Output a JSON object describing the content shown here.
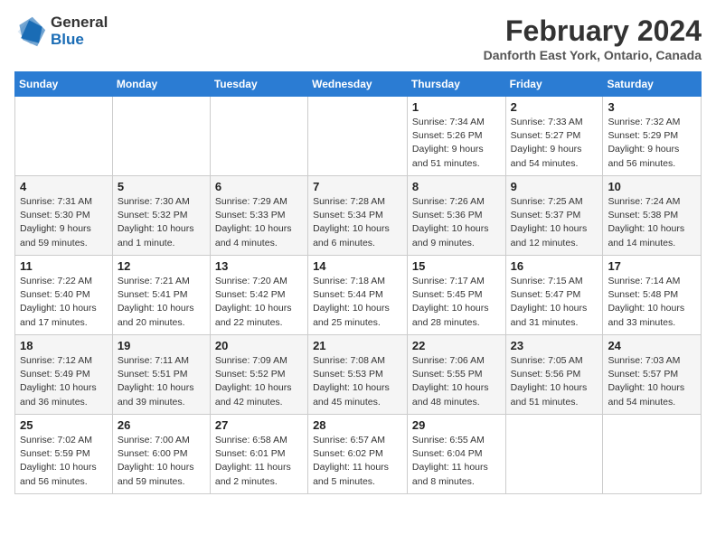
{
  "logo": {
    "line1": "General",
    "line2": "Blue"
  },
  "title": "February 2024",
  "location": "Danforth East York, Ontario, Canada",
  "weekdays": [
    "Sunday",
    "Monday",
    "Tuesday",
    "Wednesday",
    "Thursday",
    "Friday",
    "Saturday"
  ],
  "weeks": [
    [
      {
        "num": "",
        "info": ""
      },
      {
        "num": "",
        "info": ""
      },
      {
        "num": "",
        "info": ""
      },
      {
        "num": "",
        "info": ""
      },
      {
        "num": "1",
        "info": "Sunrise: 7:34 AM\nSunset: 5:26 PM\nDaylight: 9 hours\nand 51 minutes."
      },
      {
        "num": "2",
        "info": "Sunrise: 7:33 AM\nSunset: 5:27 PM\nDaylight: 9 hours\nand 54 minutes."
      },
      {
        "num": "3",
        "info": "Sunrise: 7:32 AM\nSunset: 5:29 PM\nDaylight: 9 hours\nand 56 minutes."
      }
    ],
    [
      {
        "num": "4",
        "info": "Sunrise: 7:31 AM\nSunset: 5:30 PM\nDaylight: 9 hours\nand 59 minutes."
      },
      {
        "num": "5",
        "info": "Sunrise: 7:30 AM\nSunset: 5:32 PM\nDaylight: 10 hours\nand 1 minute."
      },
      {
        "num": "6",
        "info": "Sunrise: 7:29 AM\nSunset: 5:33 PM\nDaylight: 10 hours\nand 4 minutes."
      },
      {
        "num": "7",
        "info": "Sunrise: 7:28 AM\nSunset: 5:34 PM\nDaylight: 10 hours\nand 6 minutes."
      },
      {
        "num": "8",
        "info": "Sunrise: 7:26 AM\nSunset: 5:36 PM\nDaylight: 10 hours\nand 9 minutes."
      },
      {
        "num": "9",
        "info": "Sunrise: 7:25 AM\nSunset: 5:37 PM\nDaylight: 10 hours\nand 12 minutes."
      },
      {
        "num": "10",
        "info": "Sunrise: 7:24 AM\nSunset: 5:38 PM\nDaylight: 10 hours\nand 14 minutes."
      }
    ],
    [
      {
        "num": "11",
        "info": "Sunrise: 7:22 AM\nSunset: 5:40 PM\nDaylight: 10 hours\nand 17 minutes."
      },
      {
        "num": "12",
        "info": "Sunrise: 7:21 AM\nSunset: 5:41 PM\nDaylight: 10 hours\nand 20 minutes."
      },
      {
        "num": "13",
        "info": "Sunrise: 7:20 AM\nSunset: 5:42 PM\nDaylight: 10 hours\nand 22 minutes."
      },
      {
        "num": "14",
        "info": "Sunrise: 7:18 AM\nSunset: 5:44 PM\nDaylight: 10 hours\nand 25 minutes."
      },
      {
        "num": "15",
        "info": "Sunrise: 7:17 AM\nSunset: 5:45 PM\nDaylight: 10 hours\nand 28 minutes."
      },
      {
        "num": "16",
        "info": "Sunrise: 7:15 AM\nSunset: 5:47 PM\nDaylight: 10 hours\nand 31 minutes."
      },
      {
        "num": "17",
        "info": "Sunrise: 7:14 AM\nSunset: 5:48 PM\nDaylight: 10 hours\nand 33 minutes."
      }
    ],
    [
      {
        "num": "18",
        "info": "Sunrise: 7:12 AM\nSunset: 5:49 PM\nDaylight: 10 hours\nand 36 minutes."
      },
      {
        "num": "19",
        "info": "Sunrise: 7:11 AM\nSunset: 5:51 PM\nDaylight: 10 hours\nand 39 minutes."
      },
      {
        "num": "20",
        "info": "Sunrise: 7:09 AM\nSunset: 5:52 PM\nDaylight: 10 hours\nand 42 minutes."
      },
      {
        "num": "21",
        "info": "Sunrise: 7:08 AM\nSunset: 5:53 PM\nDaylight: 10 hours\nand 45 minutes."
      },
      {
        "num": "22",
        "info": "Sunrise: 7:06 AM\nSunset: 5:55 PM\nDaylight: 10 hours\nand 48 minutes."
      },
      {
        "num": "23",
        "info": "Sunrise: 7:05 AM\nSunset: 5:56 PM\nDaylight: 10 hours\nand 51 minutes."
      },
      {
        "num": "24",
        "info": "Sunrise: 7:03 AM\nSunset: 5:57 PM\nDaylight: 10 hours\nand 54 minutes."
      }
    ],
    [
      {
        "num": "25",
        "info": "Sunrise: 7:02 AM\nSunset: 5:59 PM\nDaylight: 10 hours\nand 56 minutes."
      },
      {
        "num": "26",
        "info": "Sunrise: 7:00 AM\nSunset: 6:00 PM\nDaylight: 10 hours\nand 59 minutes."
      },
      {
        "num": "27",
        "info": "Sunrise: 6:58 AM\nSunset: 6:01 PM\nDaylight: 11 hours\nand 2 minutes."
      },
      {
        "num": "28",
        "info": "Sunrise: 6:57 AM\nSunset: 6:02 PM\nDaylight: 11 hours\nand 5 minutes."
      },
      {
        "num": "29",
        "info": "Sunrise: 6:55 AM\nSunset: 6:04 PM\nDaylight: 11 hours\nand 8 minutes."
      },
      {
        "num": "",
        "info": ""
      },
      {
        "num": "",
        "info": ""
      }
    ]
  ]
}
